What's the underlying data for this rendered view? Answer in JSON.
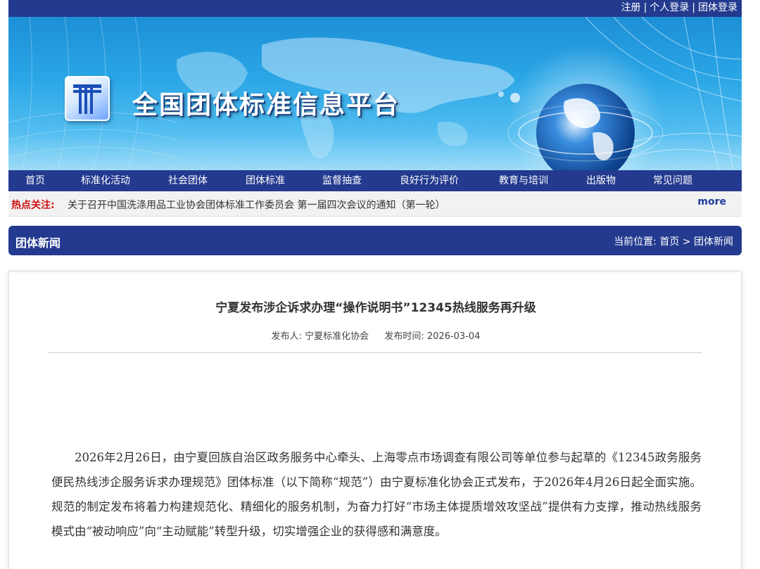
{
  "top_links": {
    "register": "注册",
    "personal_login": "个人登录",
    "group_login": "团体登录",
    "separator": "|"
  },
  "banner": {
    "site_title": "全国团体标准信息平台"
  },
  "nav": {
    "items": [
      {
        "label": "首页"
      },
      {
        "label": "标准化活动"
      },
      {
        "label": "社会团体"
      },
      {
        "label": "团体标准"
      },
      {
        "label": "监督抽查"
      },
      {
        "label": "良好行为评价"
      },
      {
        "label": "教育与培训"
      },
      {
        "label": "出版物"
      },
      {
        "label": "常见问题"
      }
    ]
  },
  "hot": {
    "label": "热点关注:",
    "text": "关于召开中国洗涤用品工业协会团体标准工作委员会 第一届四次会议的通知（第一轮）",
    "more": "more"
  },
  "section": {
    "title": "团体新闻",
    "breadcrumb_prefix": "当前位置:",
    "breadcrumb_home": "首页",
    "breadcrumb_sep": ">",
    "breadcrumb_current": "团体新闻"
  },
  "article": {
    "title": "宁夏发布涉企诉求办理“操作说明书”12345热线服务再升级",
    "publisher_label": "发布人:",
    "publisher": "宁夏标准化协会",
    "time_label": "发布时间:",
    "time": "2026-03-04",
    "paragraph": "2026年2月26日，由宁夏回族自治区政务服务中心牵头、上海零点市场调查有限公司等单位参与起草的《12345政务服务便民热线涉企服务诉求办理规范》团体标准（以下简称“规范”）由宁夏标准化协会正式发布，于2026年4月26日起全面实施。规范的制定发布将着力构建规范化、精细化的服务机制，为奋力打好“市场主体提质增效攻坚战”提供有力支撑，推动热线服务模式由“被动响应”向“主动赋能”转型升级，切实增强企业的获得感和满意度。"
  },
  "colors": {
    "brand_blue": "#233a8f",
    "hot_red": "#d01010"
  }
}
